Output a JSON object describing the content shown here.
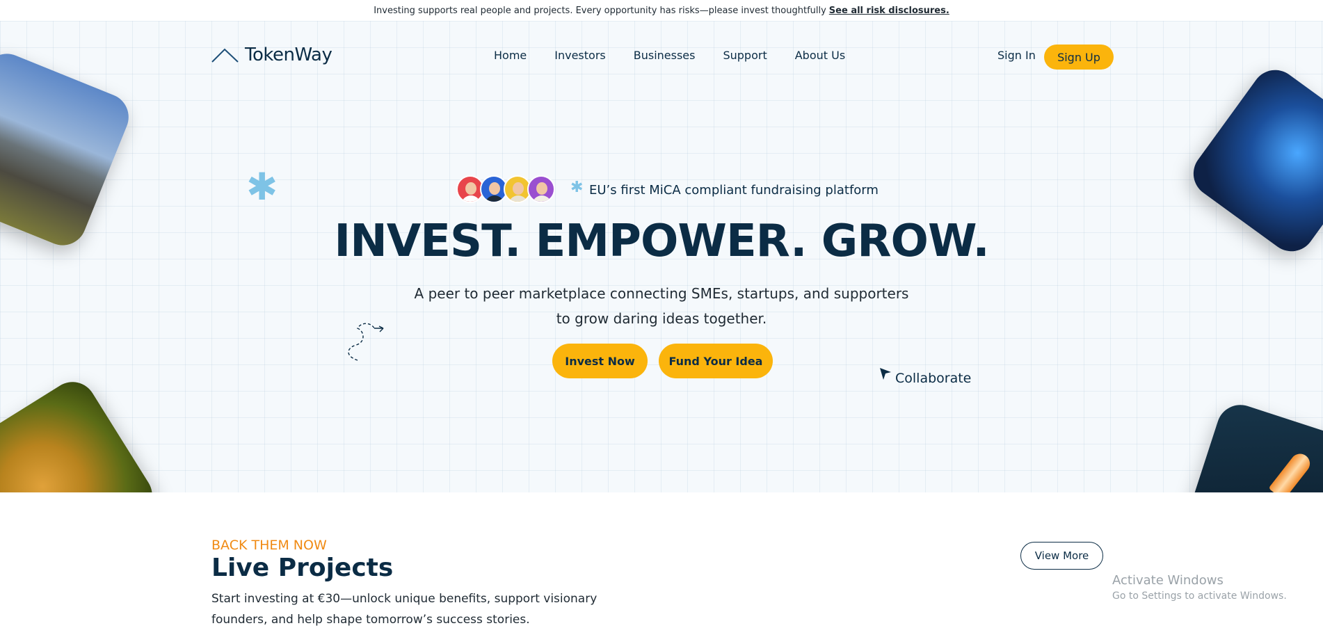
{
  "topbar": {
    "notice": "Investing supports real people and projects. Every opportunity has risks—please invest thoughtfully",
    "link": "See all risk disclosures."
  },
  "header": {
    "logo": "TokenWay",
    "nav": [
      "Home",
      "Investors",
      "Businesses",
      "Support",
      "About Us"
    ],
    "sign_in": "Sign In",
    "sign_up": "Sign Up"
  },
  "hero": {
    "badge": "EU’s first MiCA compliant fundraising platform",
    "headline": "INVEST. EMPOWER. GROW.",
    "sub_line1": "A peer to peer marketplace connecting SMEs, startups, and supporters",
    "sub_line2": "to grow daring ideas together.",
    "cta_invest": "Invest Now",
    "cta_fund": "Fund Your Idea",
    "cursor_label": "Collaborate"
  },
  "avatars": [
    {
      "bg": "#e8454b"
    },
    {
      "bg": "#2a64d6"
    },
    {
      "bg": "#f2c431"
    },
    {
      "bg": "#9a4fd0"
    }
  ],
  "colors": {
    "accent": "#fbb40c",
    "navy": "#0b2c45",
    "eyebrow": "#f08a13",
    "star": "#7ec3e6"
  },
  "live_projects": {
    "eyebrow": "BACK THEM NOW",
    "title": "Live Projects",
    "description": "Start investing at €30—unlock unique benefits, support visionary founders, and help shape tomorrow’s success stories.",
    "view_more": "View More"
  },
  "windows_watermark": {
    "title": "Activate Windows",
    "subtitle": "Go to Settings to activate Windows."
  }
}
